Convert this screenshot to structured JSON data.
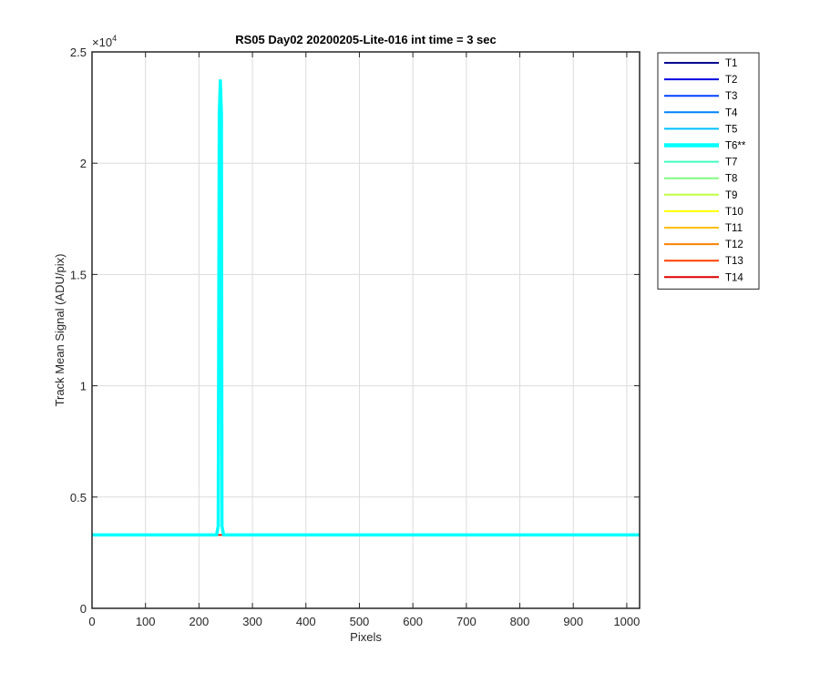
{
  "chart_data": {
    "type": "line",
    "title": "RS05 Day02 20200205-Lite-016 int time = 3 sec",
    "xlabel": "Pixels",
    "ylabel": "Track Mean Signal (ADU/pix)",
    "xlim": [
      0,
      1024
    ],
    "ylim": [
      0,
      25000
    ],
    "x_ticks": [
      0,
      100,
      200,
      300,
      400,
      500,
      600,
      700,
      800,
      900,
      1000
    ],
    "y_ticks": [
      0,
      5000,
      10000,
      15000,
      20000,
      25000
    ],
    "y_tick_labels": [
      "0",
      "0.5",
      "1",
      "1.5",
      "2",
      "2.5"
    ],
    "y_exponent_base": "×10",
    "y_exponent_power": "4",
    "grid": true,
    "legend_position": "outside-top-right",
    "baseline": 3300,
    "series": [
      {
        "name": "T1",
        "color": "#00008f",
        "value": 3300
      },
      {
        "name": "T2",
        "color": "#0000df",
        "value": 3300
      },
      {
        "name": "T3",
        "color": "#0040ff",
        "value": 3300
      },
      {
        "name": "T4",
        "color": "#0080ff",
        "value": 3300
      },
      {
        "name": "T5",
        "color": "#00bfff",
        "value": 3300
      },
      {
        "name": "T6**",
        "color": "#00ffff",
        "value": 3300,
        "highlighted": true,
        "peak": {
          "x_start": 233,
          "x_peak": 240,
          "x_end": 246,
          "y_peak": 23700
        }
      },
      {
        "name": "T7",
        "color": "#40ffbf",
        "value": 3300
      },
      {
        "name": "T8",
        "color": "#80ff80",
        "value": 3300
      },
      {
        "name": "T9",
        "color": "#bfff40",
        "value": 3300
      },
      {
        "name": "T10",
        "color": "#ffff00",
        "value": 3300
      },
      {
        "name": "T11",
        "color": "#ffbf00",
        "value": 3300
      },
      {
        "name": "T12",
        "color": "#ff8000",
        "value": 3300
      },
      {
        "name": "T13",
        "color": "#ff4000",
        "value": 3300
      },
      {
        "name": "T14",
        "color": "#df0000",
        "value": 3300
      }
    ]
  }
}
